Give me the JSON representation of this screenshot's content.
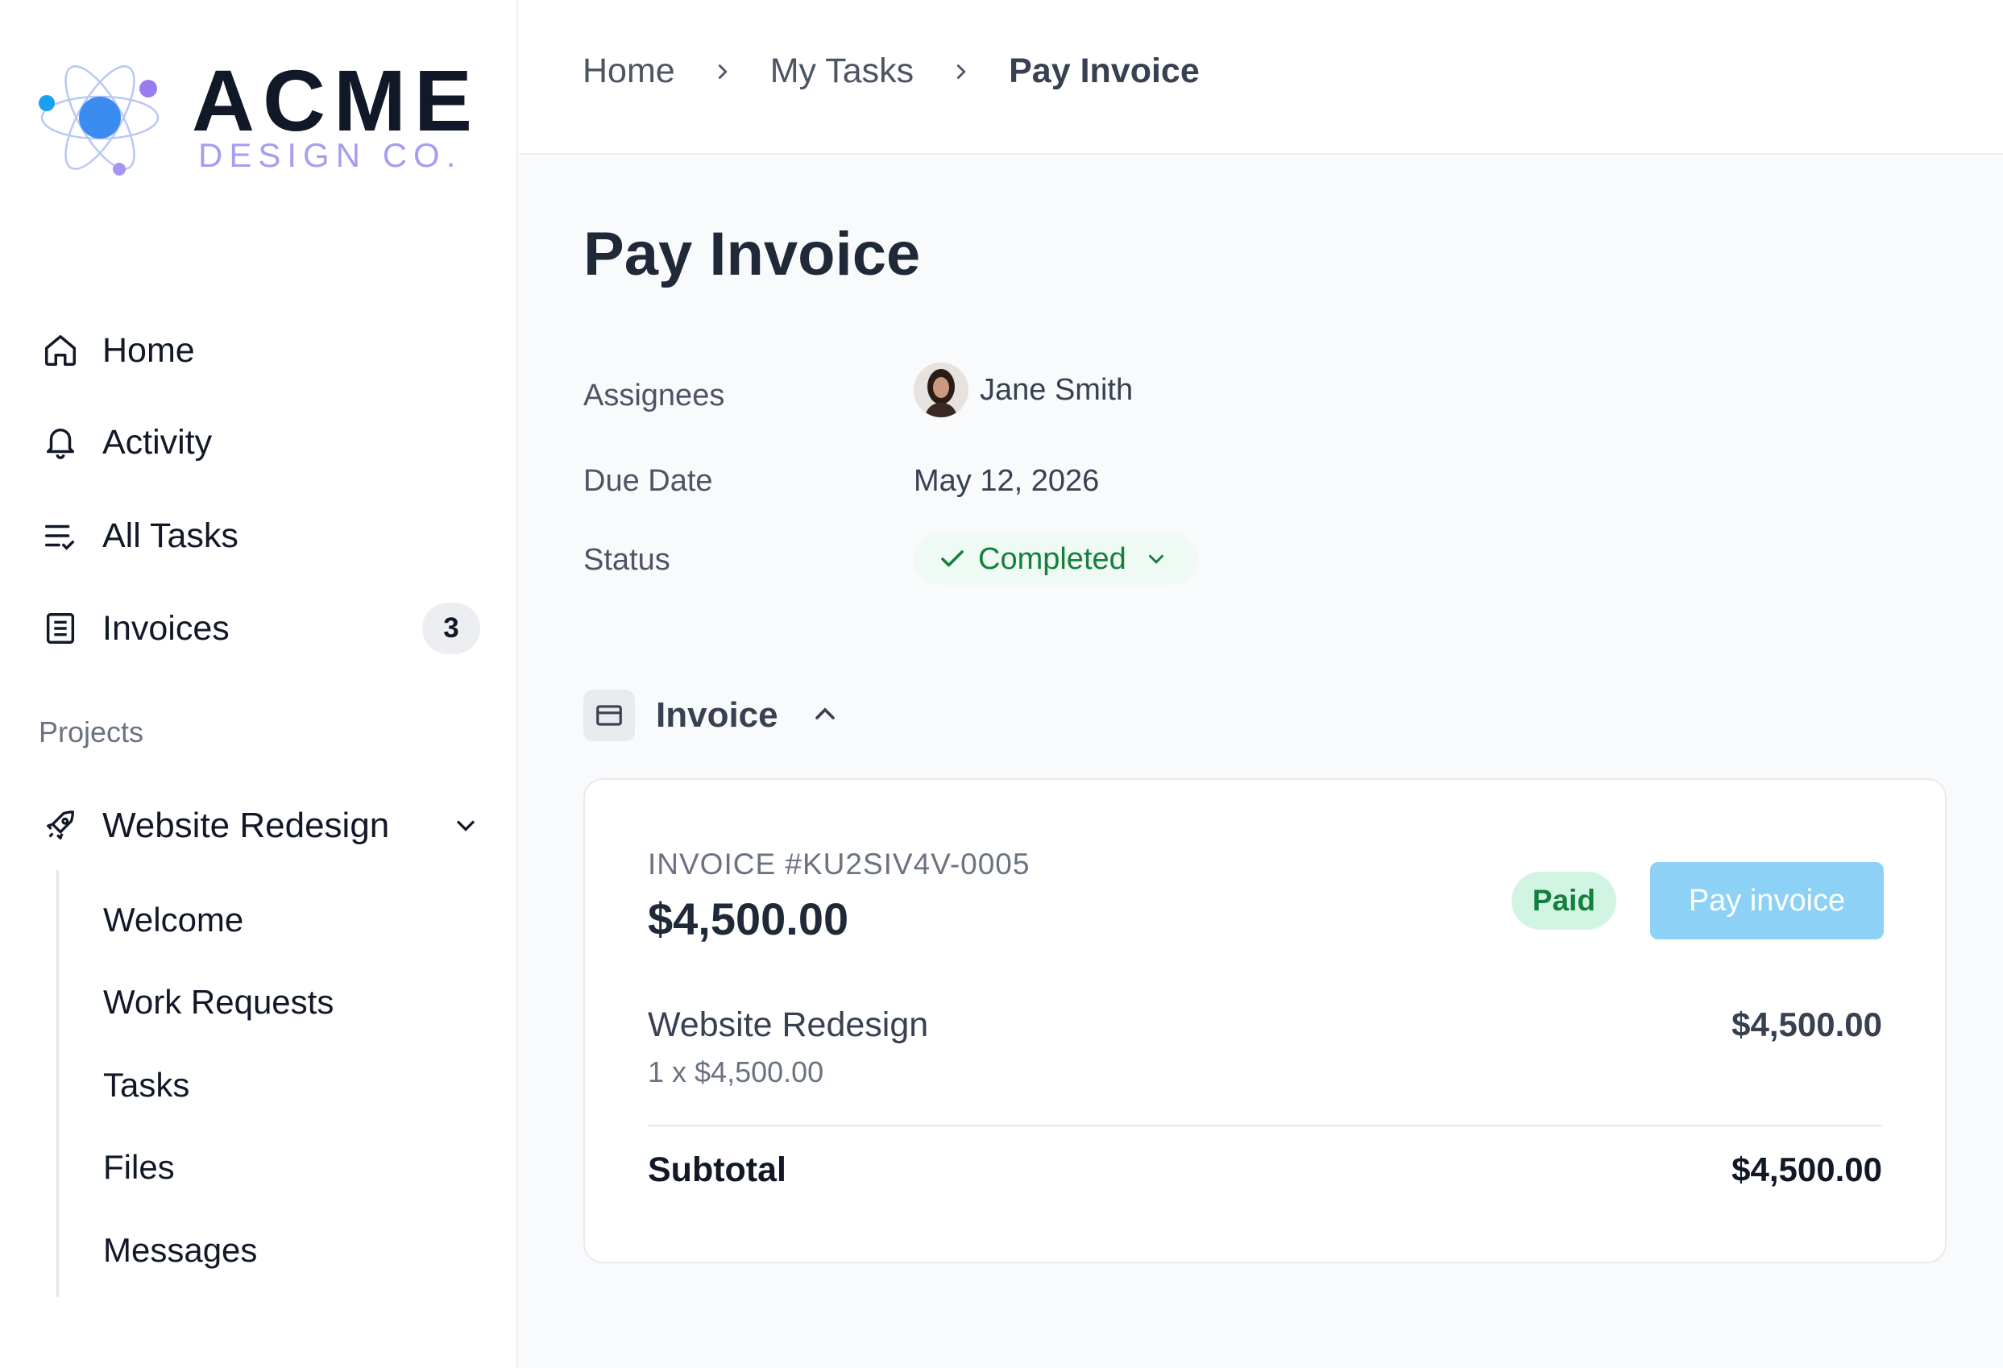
{
  "brand": {
    "name": "ACME",
    "tagline": "DESIGN CO."
  },
  "sidebar": {
    "items": [
      {
        "label": "Home",
        "icon": "home-icon"
      },
      {
        "label": "Activity",
        "icon": "bell-icon"
      },
      {
        "label": "All Tasks",
        "icon": "task-list-icon"
      },
      {
        "label": "Invoices",
        "icon": "document-icon",
        "badge": "3"
      }
    ],
    "projects_label": "Projects",
    "project": {
      "label": "Website Redesign",
      "icon": "rocket-icon",
      "children": [
        "Welcome",
        "Work Requests",
        "Tasks",
        "Files",
        "Messages"
      ]
    }
  },
  "breadcrumb": [
    "Home",
    "My Tasks",
    "Pay Invoice"
  ],
  "page": {
    "title": "Pay Invoice",
    "fields": {
      "assignees_label": "Assignees",
      "assignee_name": "Jane Smith",
      "due_label": "Due Date",
      "due_value": "May 12, 2026",
      "status_label": "Status",
      "status_value": "Completed"
    }
  },
  "invoice_section": {
    "title": "Invoice",
    "number": "INVOICE #KU2SIV4V-0005",
    "amount": "$4,500.00",
    "status_badge": "Paid",
    "pay_button": "Pay invoice",
    "line_item": {
      "name": "Website Redesign",
      "qty": "1 x $4,500.00",
      "amount": "$4,500.00"
    },
    "subtotal_label": "Subtotal",
    "subtotal_amount": "$4,500.00"
  },
  "colors": {
    "accent_blue": "#8dd2f6",
    "status_green": "#15803d",
    "status_green_bg": "#effaf4",
    "logo_purple": "#a5a0ee"
  }
}
